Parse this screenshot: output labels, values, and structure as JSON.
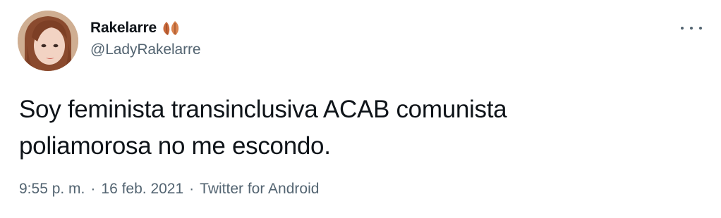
{
  "tweet": {
    "author": {
      "display_name": "Rakelarre",
      "name_emoji": "leaves-emoji",
      "handle": "@LadyRakelarre",
      "avatar": "avatar-image"
    },
    "more_icon": "more-horizontal-icon",
    "text_line1": "Soy feminista transinclusiva ACAB comunista",
    "text_line2": "poliamorosa no me escondo.",
    "time": "9:55 p. m.",
    "separator1": "·",
    "date": "16 feb. 2021",
    "separator2": "·",
    "source": "Twitter for Android"
  },
  "colors": {
    "text_primary": "#0f1419",
    "text_secondary": "#536471",
    "leaf_color": "#c8683a"
  }
}
